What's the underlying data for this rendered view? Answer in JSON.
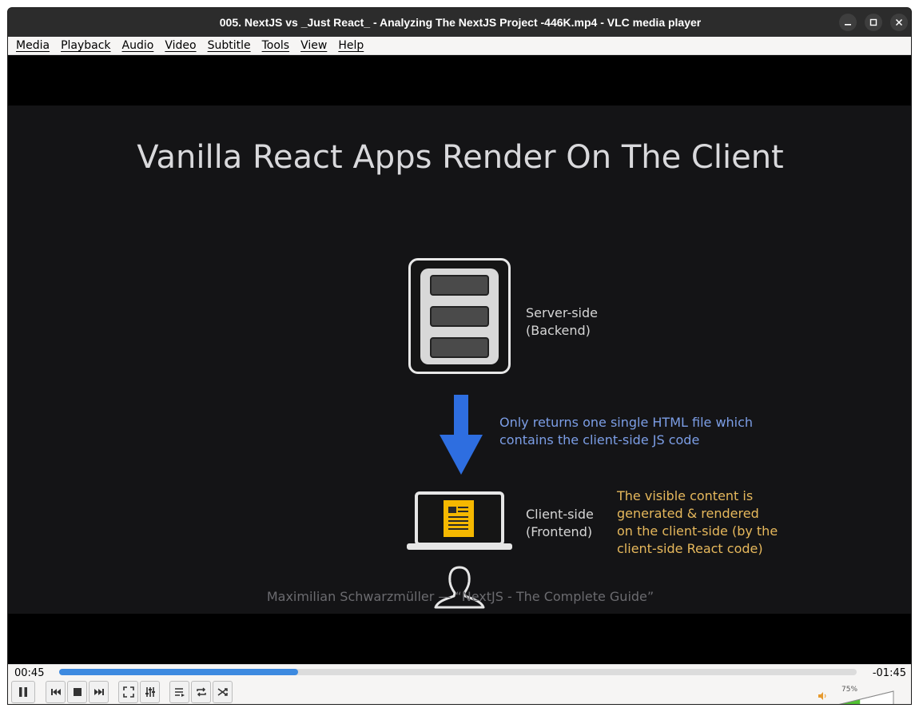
{
  "window": {
    "title": "005. NextJS vs _Just React_ - Analyzing The NextJS Project -446K.mp4 - VLC media player",
    "minimize_icon": "minimize-icon",
    "maximize_icon": "maximize-icon",
    "close_icon": "close-icon"
  },
  "menubar": {
    "items": [
      {
        "label": "Media"
      },
      {
        "label": "Playback"
      },
      {
        "label": "Audio"
      },
      {
        "label": "Video"
      },
      {
        "label": "Subtitle"
      },
      {
        "label": "Tools"
      },
      {
        "label": "View"
      },
      {
        "label": "Help"
      }
    ]
  },
  "slide": {
    "title": "Vanilla React Apps Render On The Client",
    "server_label_1": "Server-side",
    "server_label_2": "(Backend)",
    "arrow_note_1": "Only returns one single HTML file which",
    "arrow_note_2": "contains the client-side JS code",
    "client_label_1": "Client-side",
    "client_label_2": "(Frontend)",
    "client_note_1": "The visible content is",
    "client_note_2": "generated & rendered",
    "client_note_3": "on the client-side (by the",
    "client_note_4": "client-side React code)",
    "credit": "Maximilian Schwarzmüller — “NextJS - The Complete Guide”",
    "colors": {
      "arrow": "#2e6ee0",
      "doc": "#f5b800",
      "note_blue": "#7c9ee6",
      "note_yellow": "#e6b85c"
    }
  },
  "player": {
    "elapsed": "00:45",
    "remaining": "-01:45",
    "progress_fraction": 0.3,
    "volume_label": "75%",
    "volume_fraction": 0.75,
    "buttons": {
      "pause": "pause-icon",
      "previous": "previous-icon",
      "stop": "stop-icon",
      "next": "next-icon",
      "fullscreen": "fullscreen-icon",
      "extended": "equalizer-icon",
      "playlist": "playlist-icon",
      "loop": "loop-icon",
      "random": "shuffle-icon",
      "mute": "speaker-icon"
    }
  }
}
